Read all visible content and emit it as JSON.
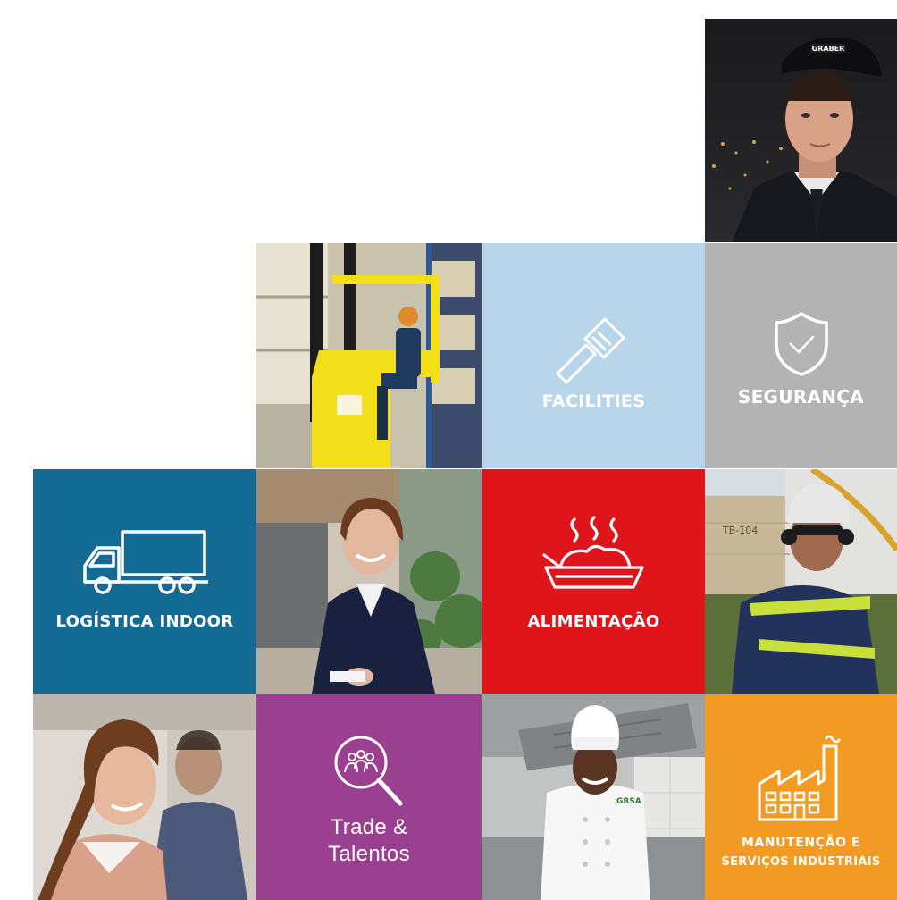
{
  "tiles": {
    "facilities": {
      "label": "FACILITIES",
      "color": "#b9d5ea",
      "icon": "screwdriver-icon"
    },
    "seguranca": {
      "label": "SEGURANÇA",
      "color": "#b3b3b3",
      "icon": "shield-check-icon"
    },
    "logistica": {
      "label": "LOGÍSTICA INDOOR",
      "color": "#136a92",
      "icon": "truck-icon"
    },
    "alimentacao": {
      "label": "ALIMENTAÇÃO",
      "color": "#e0151c",
      "icon": "food-dish-icon"
    },
    "trade": {
      "label_line1": "Trade &",
      "label_line2": "Talentos",
      "color": "#9b3f91",
      "icon": "people-search-icon"
    },
    "manutencao": {
      "label_line1": "MANUTENÇÃO E",
      "label_line2": "SERVIÇOS INDUSTRIAIS",
      "color": "#f19b25",
      "icon": "factory-icon"
    }
  },
  "photos": {
    "security_guard": {
      "cap_text": "GRABER"
    },
    "forklift": {},
    "receptionist": {},
    "industrial_worker": {
      "tank_text": "TB-104"
    },
    "businesswoman": {},
    "chef": {
      "badge_text": "GRSA"
    }
  }
}
